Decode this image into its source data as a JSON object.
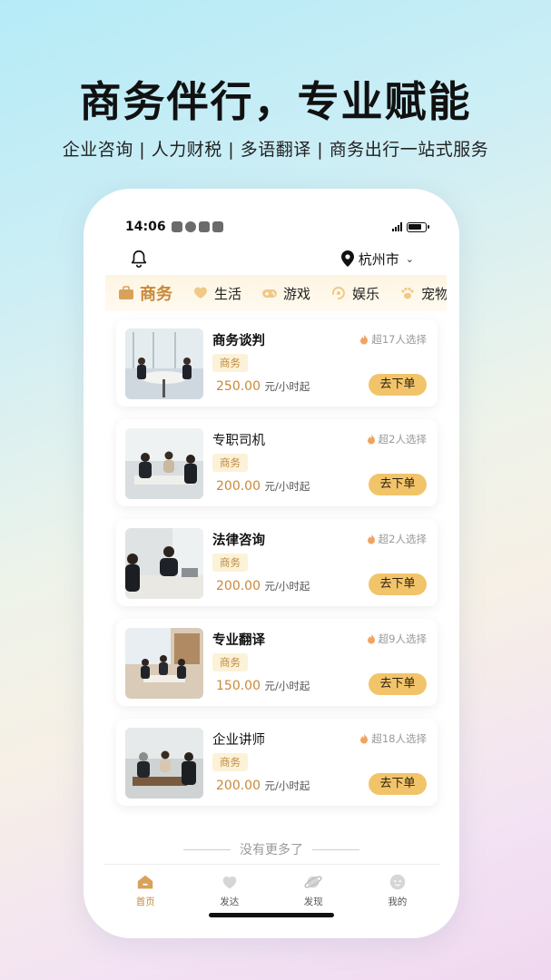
{
  "promo": {
    "headline": "商务伴行，专业赋能",
    "subline": "企业咨询 | 人力财税 | 多语翻译 | 商务出行一站式服务"
  },
  "status_bar": {
    "time": "14:06"
  },
  "header": {
    "city": "杭州市"
  },
  "categories": [
    {
      "label": "商务",
      "icon": "briefcase-icon",
      "active": true
    },
    {
      "label": "生活",
      "icon": "heart-hand-icon"
    },
    {
      "label": "游戏",
      "icon": "gamepad-icon"
    },
    {
      "label": "娱乐",
      "icon": "swirl-icon"
    },
    {
      "label": "宠物",
      "icon": "paw-icon"
    }
  ],
  "services": [
    {
      "title": "商务谈判",
      "tag": "商务",
      "price": "250.00",
      "unit": "元/小时起",
      "picks": "超17人选择",
      "order": "去下单"
    },
    {
      "title": "专职司机",
      "tag": "商务",
      "price": "200.00",
      "unit": "元/小时起",
      "picks": "超2人选择",
      "order": "去下单"
    },
    {
      "title": "法律咨询",
      "tag": "商务",
      "price": "200.00",
      "unit": "元/小时起",
      "picks": "超2人选择",
      "order": "去下单"
    },
    {
      "title": "专业翻译",
      "tag": "商务",
      "price": "150.00",
      "unit": "元/小时起",
      "picks": "超9人选择",
      "order": "去下单"
    },
    {
      "title": "企业讲师",
      "tag": "商务",
      "price": "200.00",
      "unit": "元/小时起",
      "picks": "超18人选择",
      "order": "去下单"
    }
  ],
  "list_end": "没有更多了",
  "tabbar": {
    "items": [
      {
        "label": "首页",
        "icon": "home-icon",
        "active": true
      },
      {
        "label": "发达",
        "icon": "heart-icon"
      },
      {
        "label": "发现",
        "icon": "planet-icon"
      },
      {
        "label": "我的",
        "icon": "face-icon"
      }
    ]
  },
  "colors": {
    "accent": "#c8893a",
    "button": "#f2c46a",
    "tag_bg": "#fbf2d8"
  }
}
